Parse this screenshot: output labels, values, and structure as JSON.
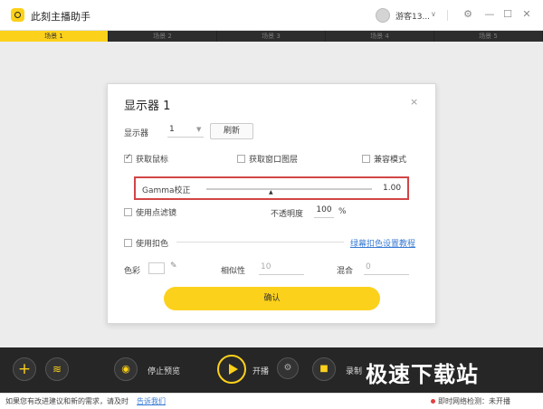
{
  "app": {
    "title": "此刻主播助手",
    "user_name": "游客13...",
    "user_caret": "∨"
  },
  "window_controls": {
    "settings": "⚙",
    "minimize": "—",
    "maximize": "☐",
    "close": "✕"
  },
  "scenes": [
    "场景 1",
    "场景 2",
    "场景 3",
    "场景 4",
    "场景 5"
  ],
  "dialog": {
    "title": "显示器 1",
    "close": "×",
    "display_label": "显示器",
    "display_value": "1",
    "display_caret": "▼",
    "refresh_label": "刷新",
    "capture_cursor_label": "获取鼠标",
    "capture_layered_label": "获取窗口图层",
    "compat_mode_label": "兼容模式",
    "gamma_label": "Gamma校正",
    "gamma_value": "1.00",
    "gamma_thumb": "▲",
    "point_filter_label": "使用点滤镜",
    "opacity_label": "不透明度",
    "opacity_value": "100",
    "opacity_unit": "%",
    "chroma_key_label": "使用扣色",
    "chroma_tutorial_link": "绿幕扣色设置教程",
    "color_label": "色彩",
    "similarity_label": "相似性",
    "similarity_value": "10",
    "blend_label": "混合",
    "blend_value": "0",
    "confirm_label": "确认"
  },
  "toolbar": {
    "add_icon": "+",
    "stop_preview_label": "停止预览",
    "start_broadcast_label": "开播",
    "record_label": "录制",
    "watermark": "极速下载站"
  },
  "statusbar": {
    "message": "如果您有改进建议和新的需求，请及时",
    "feedback_link": "告诉我们",
    "network_label": "即时网络检测：",
    "network_status": "未开播"
  },
  "colors": {
    "accent": "#fcd11b",
    "highlight_border": "#d24545",
    "toolbar_bg": "#262626"
  }
}
